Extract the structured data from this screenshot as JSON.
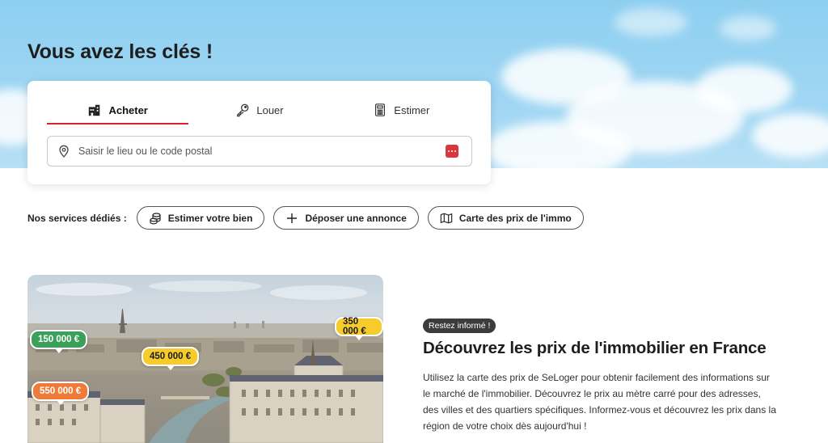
{
  "hero": {
    "title": "Vous avez les clés !"
  },
  "search": {
    "tabs": [
      {
        "label": "Acheter",
        "icon": "building-key-icon",
        "active": true
      },
      {
        "label": "Louer",
        "icon": "key-icon",
        "active": false
      },
      {
        "label": "Estimer",
        "icon": "calculator-icon",
        "active": false
      }
    ],
    "placeholder": "Saisir le lieu ou le code postal",
    "input_value": ""
  },
  "services": {
    "label": "Nos services dédiés :",
    "buttons": [
      {
        "label": "Estimer votre bien",
        "icon": "coins-icon"
      },
      {
        "label": "Déposer une annonce",
        "icon": "plus-icon"
      },
      {
        "label": "Carte des prix de l'immo",
        "icon": "map-icon"
      }
    ]
  },
  "photo": {
    "price_tags": [
      {
        "label": "150 000 €",
        "color": "green"
      },
      {
        "label": "450 000 €",
        "color": "yellow"
      },
      {
        "label": "350 000 €",
        "color": "yellow"
      },
      {
        "label": "550 000 €",
        "color": "orange"
      }
    ]
  },
  "info": {
    "badge": "Restez informé !",
    "title": "Découvrez les prix de l'immobilier en France",
    "text": "Utilisez la carte des prix de SeLoger pour obtenir facilement des informations sur le marché de l'immobilier. Découvrez le prix au mètre carré pour des adresses, des villes et des quartiers spécifiques. Informez-vous et découvrez les prix dans la région de votre choix dès aujourd'hui !"
  },
  "colors": {
    "accent_red": "#d4232b",
    "sky": "#9fd6f3",
    "tag_green": "#3aa05a",
    "tag_yellow": "#f6cc2d",
    "tag_orange": "#ee7b39"
  }
}
